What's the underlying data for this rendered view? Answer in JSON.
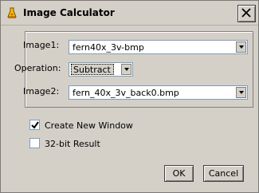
{
  "window": {
    "title": "Image Calculator",
    "close_icon": "close-icon",
    "app_icon": "imagej-flask-icon"
  },
  "form": {
    "image1": {
      "label": "Image1:",
      "value": "fern40x_3v-bmp"
    },
    "operation": {
      "label": "Operation:",
      "value": "Subtract"
    },
    "image2": {
      "label": "Image2:",
      "value": "fern_40x_3v_back0.bmp"
    }
  },
  "options": {
    "create_new_window": {
      "label": "Create New Window",
      "checked": true
    },
    "result_32bit": {
      "label": "32-bit Result",
      "checked": false
    }
  },
  "buttons": {
    "ok": "OK",
    "cancel": "Cancel"
  }
}
